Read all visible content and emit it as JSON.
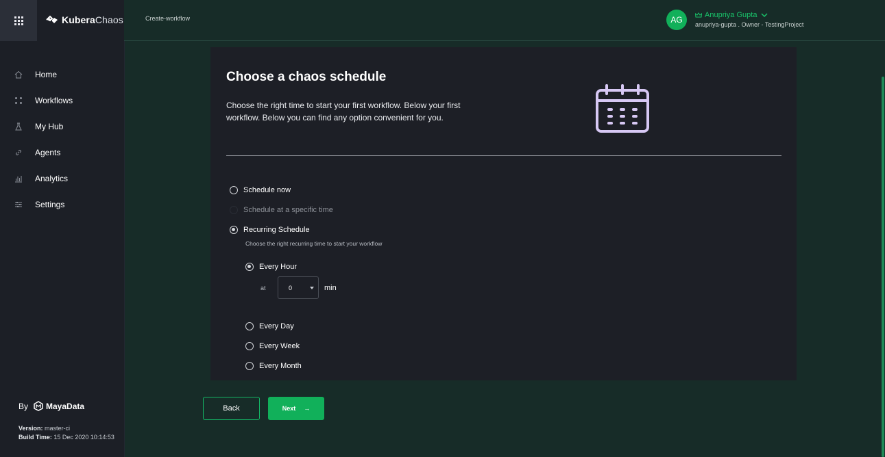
{
  "brand": {
    "bold": "Kubera",
    "light": "Chaos"
  },
  "colors": {
    "accent": "#11b05a",
    "sidebar": "#1c1f26",
    "background": "#172c28",
    "card": "#1d1f26",
    "calendar_icon": "#d7c8f4"
  },
  "sidebar": {
    "items": [
      {
        "label": "Home",
        "icon": "home-icon"
      },
      {
        "label": "Workflows",
        "icon": "workflows-icon"
      },
      {
        "label": "My Hub",
        "icon": "flask-icon"
      },
      {
        "label": "Agents",
        "icon": "link-icon"
      },
      {
        "label": "Analytics",
        "icon": "bar-chart-icon"
      },
      {
        "label": "Settings",
        "icon": "sliders-icon"
      }
    ],
    "by": "By",
    "vendor": "MayaData",
    "version_label": "Version:",
    "version": "master-ci",
    "build_label": "Build Time:",
    "build_time": "15 Dec 2020 10:14:53"
  },
  "header": {
    "breadcrumb": "Create-workflow",
    "avatar_initials": "AG",
    "user_name": "Anupriya Gupta",
    "user_sub": "anupriya-gupta . Owner - TestingProject"
  },
  "card": {
    "title": "Choose a chaos schedule",
    "description": "Choose the right time to start your first workflow. Below your first workflow. Below you can find any option convenient for you.",
    "options": {
      "now": "Schedule now",
      "specific": "Schedule at a specific time",
      "recurring": "Recurring Schedule"
    },
    "recurring_hint": "Choose the right recurring time to start your workflow",
    "recurring_options": {
      "hour": "Every Hour",
      "day": "Every Day",
      "week": "Every Week",
      "month": "Every Month"
    },
    "at_label": "at",
    "minute_value": "0",
    "min_label": "min",
    "selected": "Recurring Schedule",
    "selected_recurring": "Every Hour"
  },
  "buttons": {
    "back": "Back",
    "next": "Next",
    "next_arrow": "→"
  }
}
